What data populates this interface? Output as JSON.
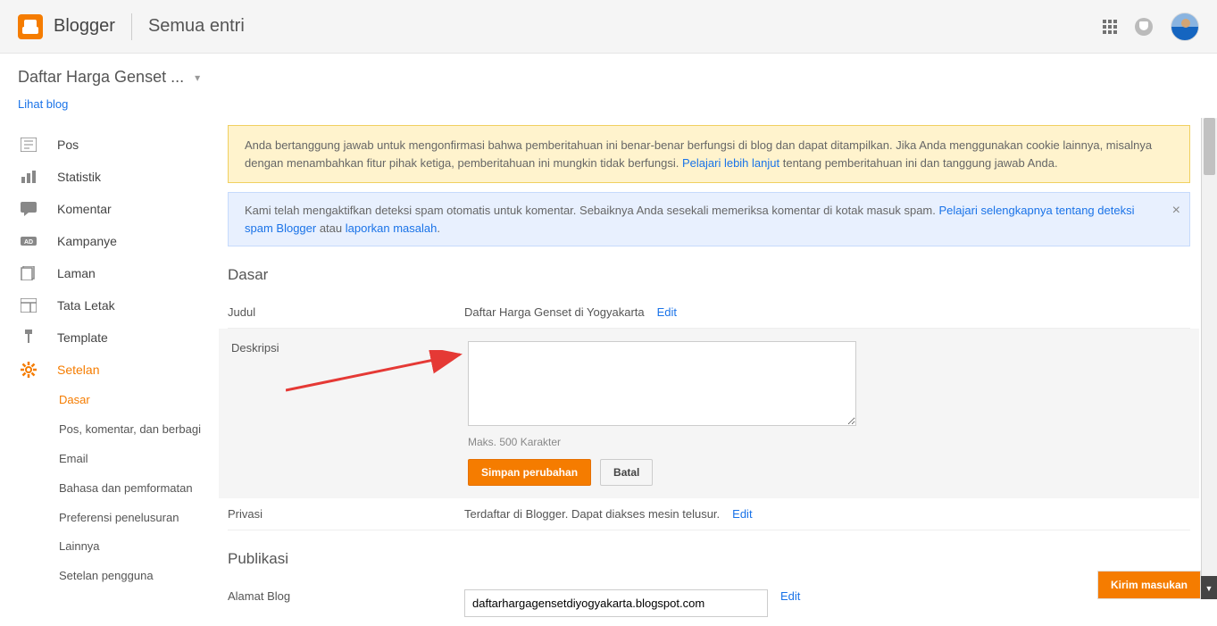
{
  "header": {
    "brand": "Blogger",
    "page_title": "Semua entri"
  },
  "subheader": {
    "blog_name": "Daftar Harga Genset ...",
    "view_link": "Lihat blog"
  },
  "sidebar": {
    "items": [
      {
        "label": "Pos"
      },
      {
        "label": "Statistik"
      },
      {
        "label": "Komentar"
      },
      {
        "label": "Kampanye"
      },
      {
        "label": "Laman"
      },
      {
        "label": "Tata Letak"
      },
      {
        "label": "Template"
      },
      {
        "label": "Setelan"
      }
    ],
    "sub_items": [
      "Dasar",
      "Pos, komentar, dan berbagi",
      "Email",
      "Bahasa dan pemformatan",
      "Preferensi penelusuran",
      "Lainnya",
      "Setelan pengguna"
    ]
  },
  "banners": {
    "warn_text": "Anda bertanggung jawab untuk mengonfirmasi bahwa pemberitahuan ini benar-benar berfungsi di blog dan dapat ditampilkan. Jika Anda menggunakan cookie lainnya, misalnya dengan menambahkan fitur pihak ketiga, pemberitahuan ini mungkin tidak berfungsi. ",
    "warn_link": "Pelajari lebih lanjut",
    "warn_tail": " tentang pemberitahuan ini dan tanggung jawab Anda.",
    "info_text_1": "Kami telah mengaktifkan deteksi spam otomatis untuk komentar. Sebaiknya Anda sesekali memeriksa komentar di kotak masuk spam. ",
    "info_link_1": "Pelajari selengkapnya tentang deteksi spam Blogger",
    "info_mid": " atau ",
    "info_link_2": "laporkan masalah",
    "info_tail": "."
  },
  "basic": {
    "section_title": "Dasar",
    "title_label": "Judul",
    "title_value": "Daftar Harga Genset di Yogyakarta",
    "edit_link": "Edit",
    "desc_label": "Deskripsi",
    "desc_hint": "Maks. 500 Karakter",
    "save_btn": "Simpan perubahan",
    "cancel_btn": "Batal",
    "privacy_label": "Privasi",
    "privacy_value": "Terdaftar di Blogger. Dapat diakses mesin telusur."
  },
  "publish": {
    "section_title": "Publikasi",
    "addr_label": "Alamat Blog",
    "addr_value": "daftarhargagensetdiyogyakarta.blogspot.com"
  },
  "feedback": {
    "label": "Kirim masukan"
  }
}
